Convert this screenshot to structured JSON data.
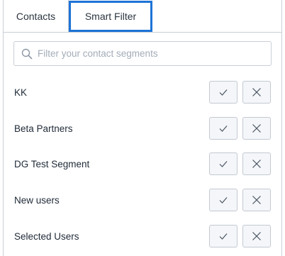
{
  "tabs": [
    {
      "label": "Contacts"
    },
    {
      "label": "Smart Filter"
    }
  ],
  "search": {
    "placeholder": "Filter your contact segments",
    "value": ""
  },
  "segments": [
    {
      "name": "KK"
    },
    {
      "name": "Beta Partners"
    },
    {
      "name": "DG Test Segment"
    },
    {
      "name": "New users"
    },
    {
      "name": "Selected Users"
    }
  ],
  "icons": {
    "search": "search-icon",
    "accept": "check-icon",
    "reject": "close-icon"
  },
  "colors": {
    "active_tab_outline": "#1e73d6",
    "border": "#c9ced6",
    "button_bg": "#f4f6f9",
    "placeholder": "#a3acb8"
  }
}
